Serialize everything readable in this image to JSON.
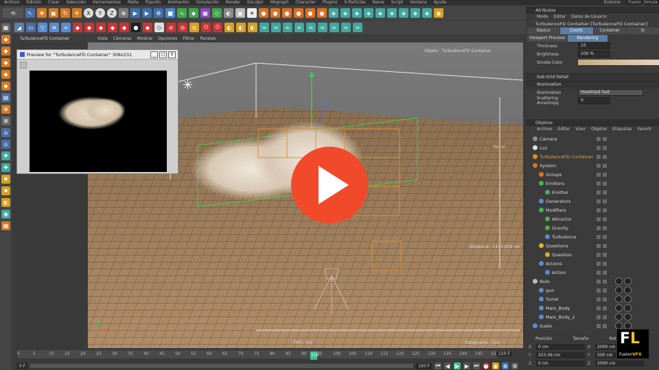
{
  "menubar": {
    "items": [
      "Archivo",
      "Edición",
      "Crear",
      "Selección",
      "Herramientas",
      "Malla",
      "Fijación",
      "Animación",
      "Simulación",
      "Render",
      "Esculpir",
      "Mograph",
      "Character",
      "Plugins",
      "X-Particles",
      "Naive",
      "Script",
      "Ventana",
      "Ayuda"
    ],
    "right": "Entorno:",
    "right_value": "Fusión_Simula"
  },
  "toolbar": {
    "axis_x": "X",
    "axis_y": "Y",
    "axis_z": "Z"
  },
  "viewport": {
    "tab": "TurbulenceFD Container",
    "menu": [
      "Vista",
      "Cámaras",
      "Mostrar",
      "Opciones",
      "Filtrar",
      "Paneles"
    ],
    "object_label": "Objeto : TurbulenceFD Container",
    "move_label": "Mover",
    "distance": "Distancia : 2143.839 cm",
    "fps": "FPS : 0.0",
    "frame_label": "Fotograma : 110"
  },
  "preview": {
    "title": "Preview for \"TurbulenceFD Container\" 308x231",
    "btn_min": "_",
    "btn_max": "□",
    "btn_close": "X"
  },
  "attributes": {
    "title": "Atributos",
    "menu": [
      "Modo",
      "Editar",
      "Datos de Usuario"
    ],
    "object": "TurbulenceFD Container [TurbulenceFD Container]",
    "tabs_row1": [
      "Básico",
      "Coord.",
      "Container",
      "Si"
    ],
    "tabs_row2": [
      "Viewport Preview",
      "Rendering"
    ],
    "thickness_label": "Thickness",
    "thickness_value": "15",
    "brightness_label": "Brightness",
    "brightness_value": "100 %",
    "smoke_color_label": "Smoke Color",
    "section_subgrid": "Sub-Grid Detail",
    "section_illumination": "Illumination",
    "illumination_label": "Illumination",
    "illumination_value": "Voxelized Fast",
    "scattering_label": "Scattering Anisotropy",
    "scattering_value": "0"
  },
  "objects": {
    "title": "Objetos",
    "menu": [
      "Archivo",
      "Editar",
      "Visor",
      "Objetos",
      "Etiquetas",
      "Favorit"
    ],
    "items": [
      {
        "name": "Cámara",
        "color": "#8a8a8a",
        "indent": 0
      },
      {
        "name": "Luz",
        "color": "#e0e0e0",
        "indent": 0
      },
      {
        "name": "TurbulenceFD Container",
        "color": "#e68a2e",
        "indent": 0,
        "selected": true
      },
      {
        "name": "System",
        "color": "#e07020",
        "indent": 0
      },
      {
        "name": "Groups",
        "color": "#e07020",
        "indent": 1
      },
      {
        "name": "Emitters",
        "color": "#4ab04a",
        "indent": 1
      },
      {
        "name": "Emitter",
        "color": "#4ab04a",
        "indent": 2
      },
      {
        "name": "Generators",
        "color": "#5a8ad0",
        "indent": 1
      },
      {
        "name": "Modifiers",
        "color": "#4ab04a",
        "indent": 1
      },
      {
        "name": "Attractor",
        "color": "#4ab04a",
        "indent": 2
      },
      {
        "name": "Gravity",
        "color": "#4ab04a",
        "indent": 2
      },
      {
        "name": "Turbulence",
        "color": "#5a8ad0",
        "indent": 2
      },
      {
        "name": "Questions",
        "color": "#e0b020",
        "indent": 1
      },
      {
        "name": "Question",
        "color": "#e0b020",
        "indent": 2
      },
      {
        "name": "Actions",
        "color": "#5a8ad0",
        "indent": 1
      },
      {
        "name": "Action",
        "color": "#5a8ad0",
        "indent": 2
      },
      {
        "name": "Nulo",
        "color": "#bbbbbb",
        "indent": 0
      },
      {
        "name": "gun",
        "color": "#5a8ad0",
        "indent": 1
      },
      {
        "name": "Turret",
        "color": "#5a8ad0",
        "indent": 1
      },
      {
        "name": "Main_Body",
        "color": "#5a8ad0",
        "indent": 1
      },
      {
        "name": "Main_Body_2",
        "color": "#5a8ad0",
        "indent": 1
      },
      {
        "name": "Suelo",
        "color": "#5a8ad0",
        "indent": 0
      }
    ]
  },
  "coordinates": {
    "col1": "Posición",
    "col2": "Tamaño",
    "col3": "Rota",
    "x_pos": "0 cm",
    "y_pos": "253.09 cm",
    "z_pos": "0 cm",
    "x_size": "2000 cm",
    "y_size": "500 cm",
    "z_size": "2000 cm",
    "axis_x": "X",
    "axis_y": "Y",
    "axis_z": "Z"
  },
  "timeline": {
    "ticks": [
      "0",
      "5",
      "10",
      "15",
      "20",
      "25",
      "30",
      "35",
      "40",
      "45",
      "50",
      "55",
      "60",
      "65",
      "70",
      "75",
      "80",
      "85",
      "90",
      "95",
      "100",
      "105",
      "110",
      "115",
      "120",
      "125",
      "130",
      "135",
      "140",
      "145",
      "150"
    ],
    "current_frame": "110",
    "start": "0 F",
    "end": "150 F",
    "current_box": "110 F"
  },
  "logo": {
    "letter_f": "F",
    "letter_l": "L",
    "text_a": "Fusion",
    "text_b": "VFX"
  },
  "colors": {
    "play_button": "#f04a2a",
    "accent_tab": "#5a7fa8",
    "logo_yellow": "#f2c21b",
    "playhead": "#3ec08f"
  }
}
